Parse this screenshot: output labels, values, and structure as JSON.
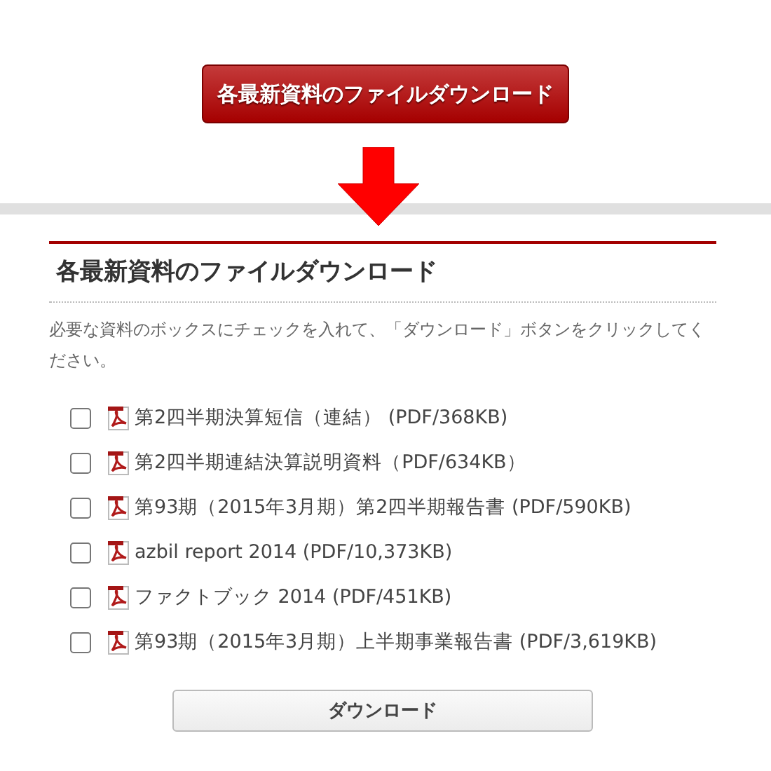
{
  "top_button": "各最新資料のファイルダウンロード",
  "section": {
    "title": "各最新資料のファイルダウンロード",
    "instructions": "必要な資料のボックスにチェックを入れて、「ダウンロード」ボタンをクリックしてください。",
    "files": [
      {
        "label": "第2四半期決算短信（連結） (PDF/368KB)",
        "checked": false
      },
      {
        "label": "第2四半期連結決算説明資料（PDF/634KB）",
        "checked": false
      },
      {
        "label": "第93期（2015年3月期）第2四半期報告書 (PDF/590KB)",
        "checked": false
      },
      {
        "label": "azbil report 2014 (PDF/10,373KB)",
        "checked": false
      },
      {
        "label": "ファクトブック 2014 (PDF/451KB)",
        "checked": false
      },
      {
        "label": "第93期（2015年3月期）上半期事業報告書 (PDF/3,619KB)",
        "checked": false
      }
    ],
    "download_button": "ダウンロード"
  }
}
